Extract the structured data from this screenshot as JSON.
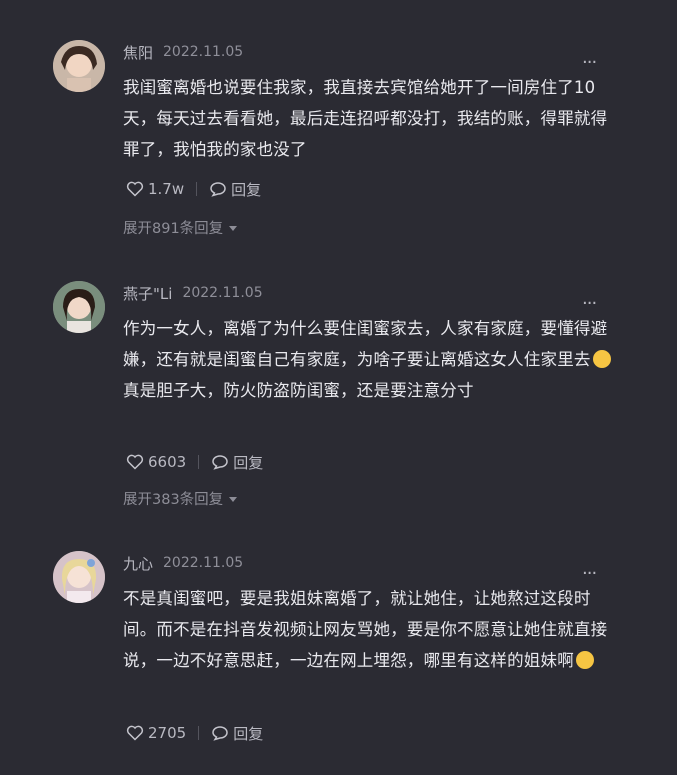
{
  "comments": [
    {
      "name": "焦阳",
      "date": "2022.11.05",
      "text": "我闺蜜离婚也说要住我家，我直接去宾馆给她开了一间房住了10天，每天过去看看她，最后走连招呼都没打，我结的账，得罪就得罪了，我怕我的家也没了",
      "likes": "1.7w",
      "reply_label": "回复",
      "expand": "展开891条回复"
    },
    {
      "name": "燕子\"Li",
      "date": "2022.11.05",
      "text_before": "作为一女人，离婚了为什么要住闺蜜家去，人家有家庭，要懂得避嫌，还有就是闺蜜自己有家庭，为啥子要让离婚这女人住家里去",
      "text_after": "真是胆子大，防火防盗防闺蜜，还是要注意分寸",
      "likes": "6603",
      "reply_label": "回复",
      "expand": "展开383条回复"
    },
    {
      "name": "九心",
      "date": "2022.11.05",
      "text_before": "不是真闺蜜吧，要是我姐妹离婚了，就让她住，让她熬过这段时间。而不是在抖音发视频让网友骂她，要是你不愿意让她住就直接说，一边不好意思赶，一边在网上埋怨，哪里有这样的姐妹啊",
      "likes": "2705",
      "reply_label": "回复"
    }
  ],
  "more_label": "..."
}
